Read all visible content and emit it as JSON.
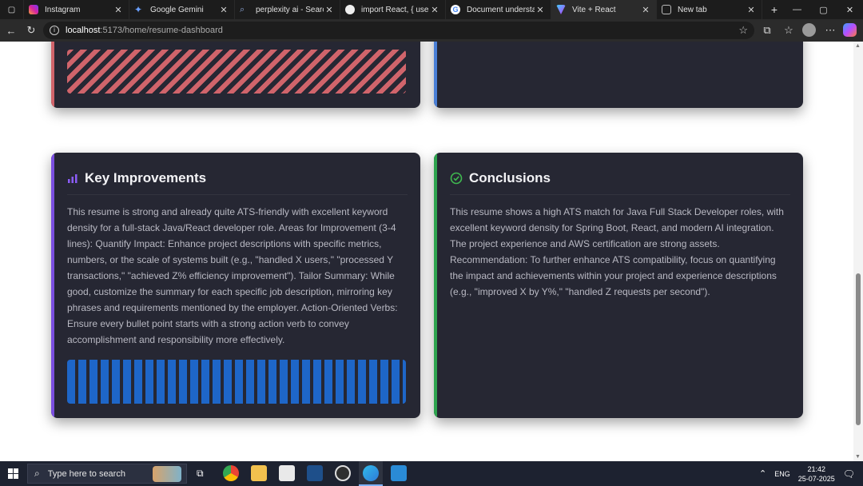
{
  "browser": {
    "tabs": [
      {
        "title": "Instagram",
        "icon": "instagram-icon"
      },
      {
        "title": "Google Gemini",
        "icon": "gemini-icon"
      },
      {
        "title": "perplexity ai - Search",
        "icon": "search-icon"
      },
      {
        "title": "import React, { useStat",
        "icon": "github-icon"
      },
      {
        "title": "Document understand",
        "icon": "google-icon"
      },
      {
        "title": "Vite + React",
        "icon": "vite-icon"
      },
      {
        "title": "New tab",
        "icon": "newtab-icon"
      }
    ],
    "url_host": "localhost",
    "url_rest": ":5173/home/resume-dashboard"
  },
  "cards": {
    "key_improvements": {
      "title": "Key Improvements",
      "text": "This resume is strong and already quite ATS-friendly with excellent keyword density for a full-stack Java/React developer role. Areas for Improvement (3-4 lines): Quantify Impact: Enhance project descriptions with specific metrics, numbers, or the scale of systems built (e.g., \"handled X users,\" \"processed Y transactions,\" \"achieved Z% efficiency improvement\"). Tailor Summary: While good, customize the summary for each specific job description, mirroring key phrases and requirements mentioned by the employer. Action-Oriented Verbs: Ensure every bullet point starts with a strong action verb to convey accomplishment and responsibility more effectively."
    },
    "conclusions": {
      "title": "Conclusions",
      "text": "This resume shows a high ATS match for Java Full Stack Developer roles, with excellent keyword density for Spring Boot, React, and modern AI integration. The project experience and AWS certification are strong assets. Recommendation: To further enhance ATS compatibility, focus on quantifying the impact and achievements within your project and experience descriptions (e.g., \"improved X by Y%,\" \"handled Z requests per second\")."
    }
  },
  "taskbar": {
    "search_placeholder": "Type here to search",
    "lang": "ENG",
    "time": "21:42",
    "date": "25-07-2025"
  },
  "colors": {
    "accent_red": "#d0646b",
    "accent_purple": "#7b4fe0",
    "accent_green": "#2ea44f",
    "accent_blue": "#1e66c8"
  }
}
